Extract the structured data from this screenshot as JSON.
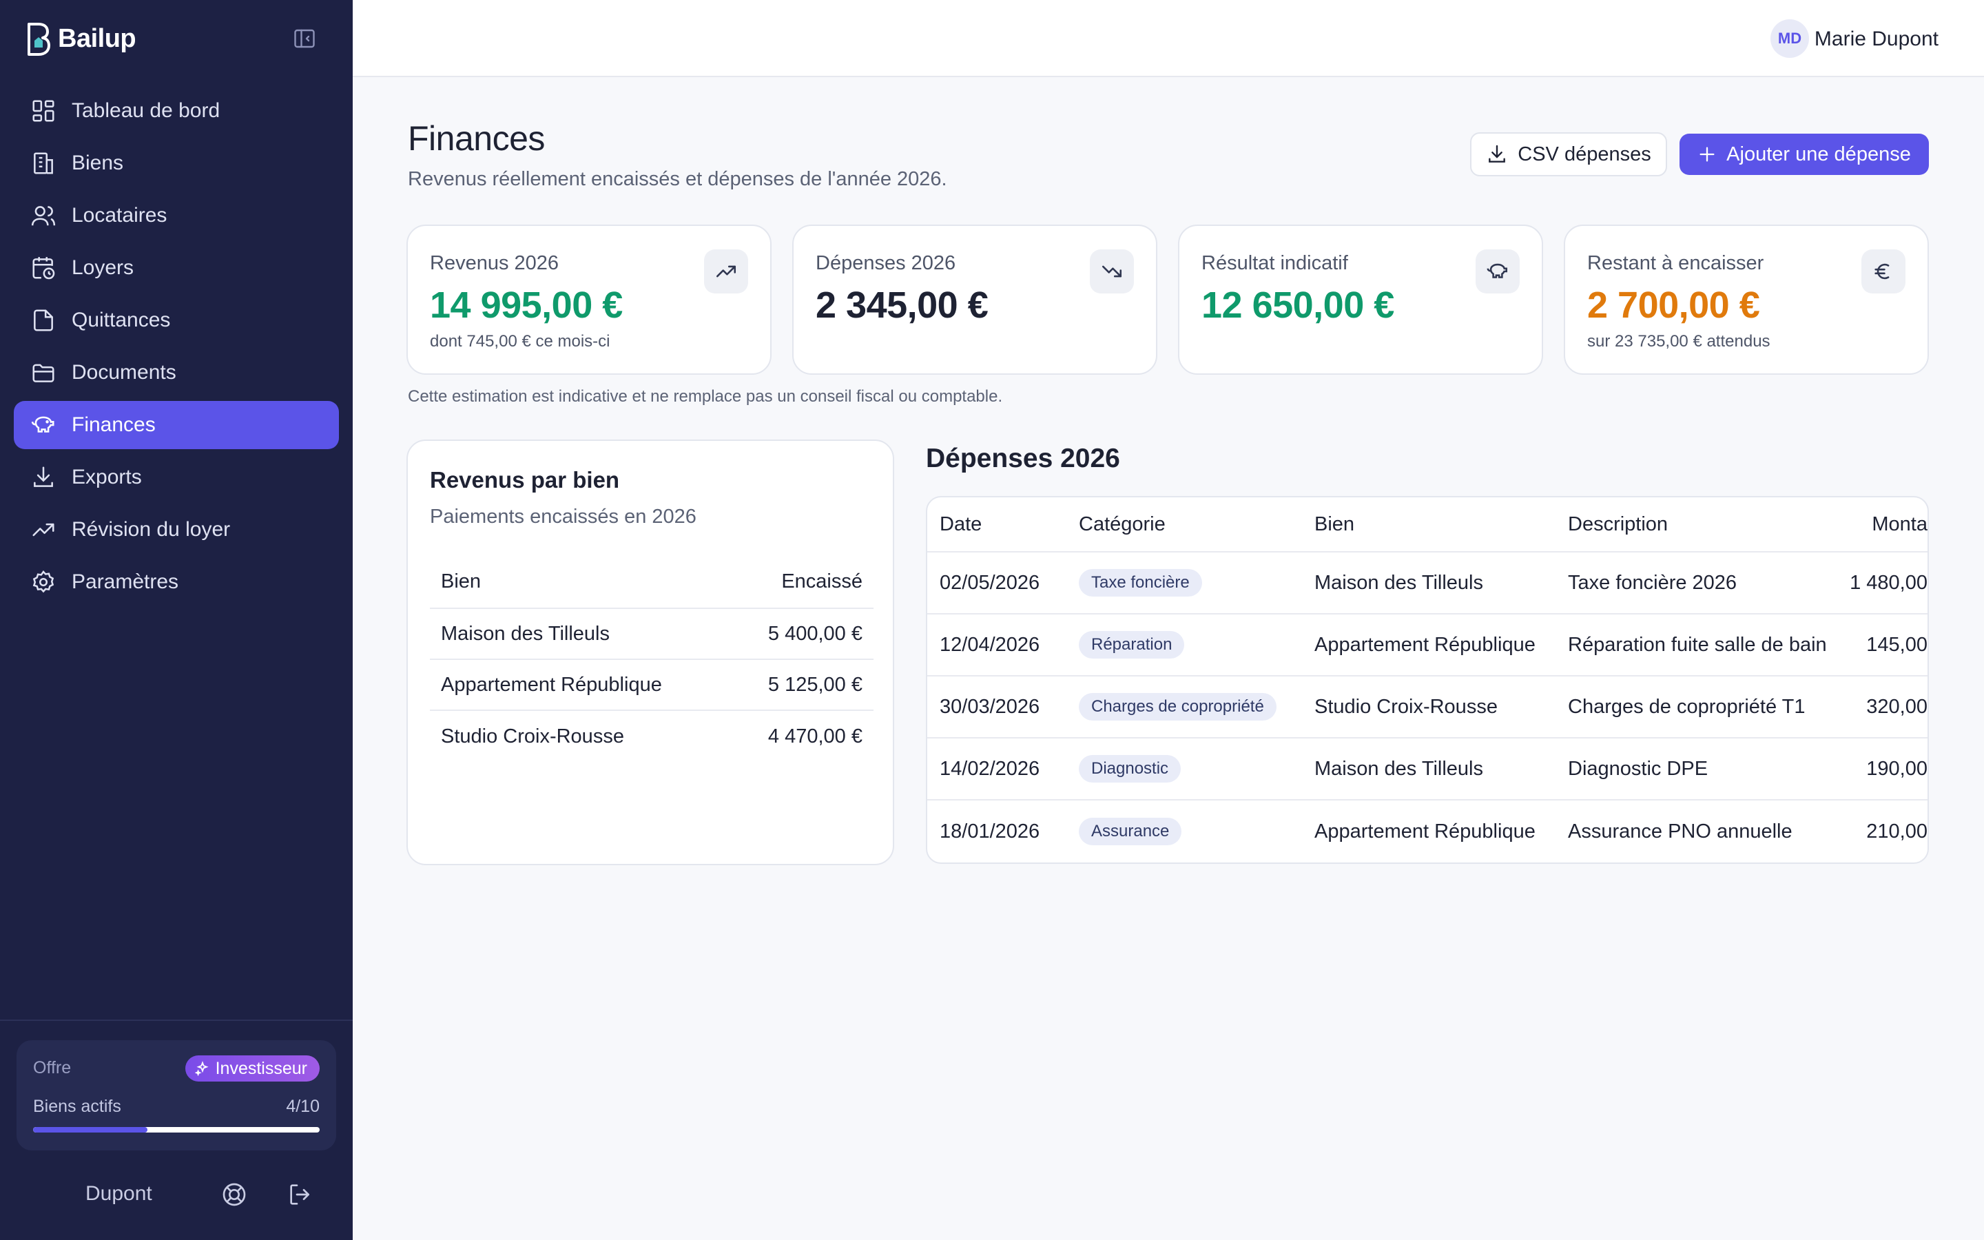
{
  "app": {
    "logo_text": "Bailup"
  },
  "sidebar": {
    "items": [
      {
        "label": "Tableau de bord",
        "icon": "dashboard-icon"
      },
      {
        "label": "Biens",
        "icon": "building-icon"
      },
      {
        "label": "Locataires",
        "icon": "users-icon"
      },
      {
        "label": "Loyers",
        "icon": "calendar-clock-icon"
      },
      {
        "label": "Quittances",
        "icon": "file-icon"
      },
      {
        "label": "Documents",
        "icon": "folder-icon"
      },
      {
        "label": "Finances",
        "icon": "piggy-bank-icon",
        "active": true
      },
      {
        "label": "Exports",
        "icon": "download-icon"
      },
      {
        "label": "Révision du loyer",
        "icon": "trending-up-icon"
      },
      {
        "label": "Paramètres",
        "icon": "gear-icon"
      }
    ],
    "plan": {
      "label": "Offre",
      "badge": "Investisseur",
      "usage_label": "Biens actifs",
      "usage_count": "4/10",
      "usage_fraction": 0.4
    },
    "footer": {
      "name": "Dupont"
    }
  },
  "topbar": {
    "avatar_initials": "MD",
    "user_name": "Marie Dupont"
  },
  "page": {
    "title": "Finances",
    "subtitle": "Revenus réellement encaissés et dépenses de l'année 2026.",
    "csv_button": "CSV dépenses",
    "add_button": "Ajouter une dépense",
    "disclaimer": "Cette estimation est indicative et ne remplace pas un conseil fiscal ou comptable."
  },
  "stats": [
    {
      "label": "Revenus 2026",
      "value": "14 995,00 €",
      "note": "dont 745,00 € ce mois-ci",
      "icon": "trending-up-icon",
      "color": "#0f9a6b"
    },
    {
      "label": "Dépenses 2026",
      "value": "2 345,00 €",
      "note": "",
      "icon": "trending-down-icon",
      "color": "#1e2233"
    },
    {
      "label": "Résultat indicatif",
      "value": "12 650,00 €",
      "note": "",
      "icon": "piggy-bank-icon",
      "color": "#0f9a6b"
    },
    {
      "label": "Restant à encaisser",
      "value": "2 700,00 €",
      "note": "sur 23 735,00 € attendus",
      "icon": "euro-icon",
      "color": "#e07a0c"
    }
  ],
  "revenue": {
    "title": "Revenus par bien",
    "subtitle": "Paiements encaissés en 2026",
    "columns": [
      "Bien",
      "Encaissé"
    ],
    "rows": [
      {
        "bien": "Maison des Tilleuls",
        "amount": "5 400,00 €"
      },
      {
        "bien": "Appartement République",
        "amount": "5 125,00 €"
      },
      {
        "bien": "Studio Croix-Rousse",
        "amount": "4 470,00 €"
      }
    ]
  },
  "expenses": {
    "title": "Dépenses 2026",
    "columns": [
      "Date",
      "Catégorie",
      "Bien",
      "Description",
      "Monta"
    ],
    "rows": [
      {
        "date": "02/05/2026",
        "category": "Taxe foncière",
        "bien": "Maison des Tilleuls",
        "description": "Taxe foncière 2026",
        "amount": "1 480,00"
      },
      {
        "date": "12/04/2026",
        "category": "Réparation",
        "bien": "Appartement République",
        "description": "Réparation fuite salle de bain",
        "amount": "145,00"
      },
      {
        "date": "30/03/2026",
        "category": "Charges de copropriété",
        "bien": "Studio Croix-Rousse",
        "description": "Charges de copropriété T1",
        "amount": "320,00"
      },
      {
        "date": "14/02/2026",
        "category": "Diagnostic",
        "bien": "Maison des Tilleuls",
        "description": "Diagnostic DPE",
        "amount": "190,00"
      },
      {
        "date": "18/01/2026",
        "category": "Assurance",
        "bien": "Appartement République",
        "description": "Assurance PNO annuelle",
        "amount": "210,00"
      }
    ]
  }
}
